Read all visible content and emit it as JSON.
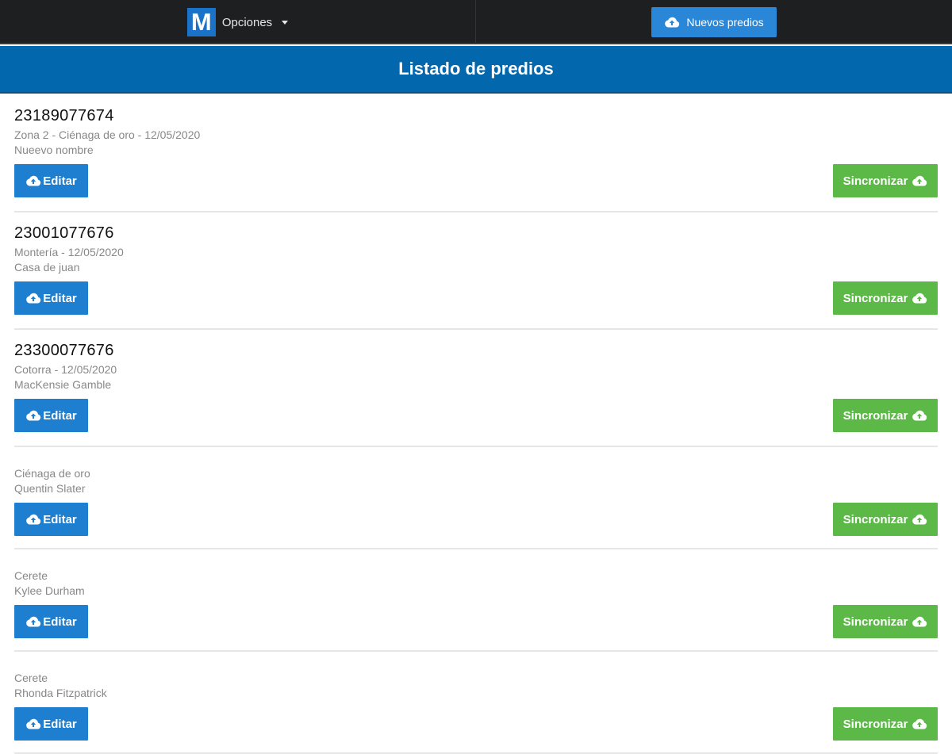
{
  "topbar": {
    "logo_letter": "M",
    "options_label": "Opciones",
    "new_button_label": "Nuevos predios"
  },
  "header": {
    "title": "Listado de predios"
  },
  "items": [
    {
      "code": "23189077674",
      "meta": "Zona 2 - Ciénaga de oro - 12/05/2020",
      "name": "Nueevo nombre"
    },
    {
      "code": "23001077676",
      "meta": "Montería - 12/05/2020",
      "name": "Casa de juan"
    },
    {
      "code": "23300077676",
      "meta": "Cotorra - 12/05/2020",
      "name": "MacKensie Gamble"
    },
    {
      "code": "",
      "meta": "Ciénaga de oro",
      "name": "Quentin Slater"
    },
    {
      "code": "",
      "meta": "Cerete",
      "name": "Kylee Durham"
    },
    {
      "code": "",
      "meta": "Cerete",
      "name": "Rhonda Fitzpatrick"
    }
  ],
  "actions": {
    "edit_label": "Editar",
    "sync_label": "Sincronizar"
  },
  "icons": {
    "cloud": "cloud-upload-icon",
    "caret": "chevron-down-icon"
  },
  "colors": {
    "topbar": "#1e1f21",
    "header": "#0367ad",
    "edit_button": "#1e7fd1",
    "sync_button": "#5cb947",
    "logo": "#1a73c8"
  }
}
